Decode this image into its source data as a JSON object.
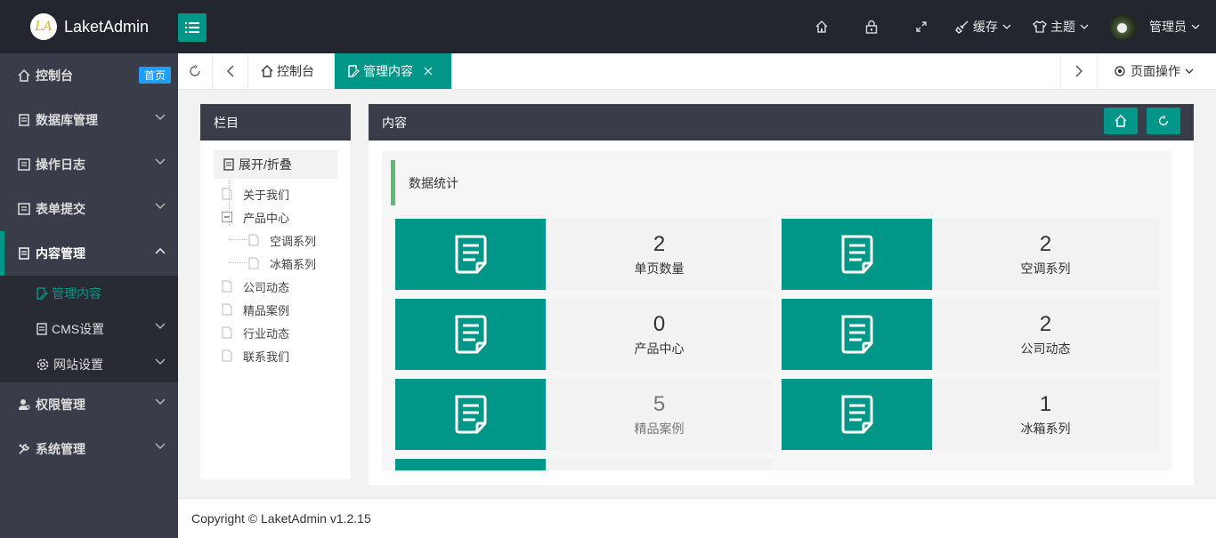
{
  "app": {
    "logo_mark": "LA",
    "title": "LaketAdmin"
  },
  "header": {
    "cache_label": "缓存",
    "theme_label": "主题",
    "user_label": "管理员"
  },
  "sidebar": {
    "items": [
      {
        "label": "控制台",
        "badge": "首页",
        "icon": "home-icon"
      },
      {
        "label": "数据库管理",
        "icon": "database-icon"
      },
      {
        "label": "操作日志",
        "icon": "log-icon"
      },
      {
        "label": "表单提交",
        "icon": "form-icon"
      },
      {
        "label": "内容管理",
        "icon": "document-icon"
      },
      {
        "label": "权限管理",
        "icon": "user-icon"
      },
      {
        "label": "系统管理",
        "icon": "wrench-icon"
      }
    ],
    "sub_items": [
      {
        "label": "管理内容",
        "icon": "edit-icon"
      },
      {
        "label": "CMS设置",
        "icon": "document-icon"
      },
      {
        "label": "网站设置",
        "icon": "gear-icon"
      }
    ]
  },
  "tabs": {
    "items": [
      {
        "label": "控制台"
      },
      {
        "label": "管理内容"
      }
    ],
    "page_ops_label": "页面操作"
  },
  "column_panel": {
    "title": "栏目",
    "expand_label": "展开/折叠",
    "tree": [
      {
        "label": "关于我们"
      },
      {
        "label": "产品中心"
      },
      {
        "label": "空调系列"
      },
      {
        "label": "冰箱系列"
      },
      {
        "label": "公司动态"
      },
      {
        "label": "精品案例"
      },
      {
        "label": "行业动态"
      },
      {
        "label": "联系我们"
      }
    ]
  },
  "content_panel": {
    "title": "内容",
    "section_title": "数据统计",
    "stats": [
      {
        "value": "2",
        "label": "单页数量"
      },
      {
        "value": "2",
        "label": "空调系列"
      },
      {
        "value": "0",
        "label": "产品中心"
      },
      {
        "value": "2",
        "label": "公司动态"
      },
      {
        "value": "5",
        "label": "精品案例"
      },
      {
        "value": "1",
        "label": "冰箱系列"
      }
    ]
  },
  "footer": {
    "copyright": "Copyright © LaketAdmin v1.2.15"
  },
  "colors": {
    "accent": "#009688",
    "dark": "#23262e",
    "sidebar": "#393d49",
    "badge": "#1e9fff"
  }
}
